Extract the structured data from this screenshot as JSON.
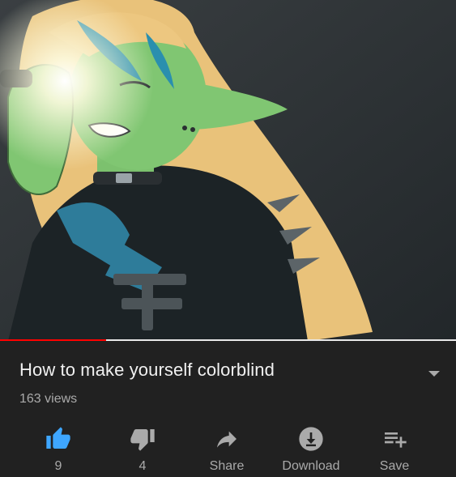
{
  "video": {
    "title": "How to make yourself colorblind",
    "views": "163 views",
    "progress_fraction": 0.232
  },
  "actions": {
    "like_count": "9",
    "dislike_count": "4",
    "share_label": "Share",
    "download_label": "Download",
    "save_label": "Save"
  },
  "colors": {
    "accent_like": "#3ea6ff",
    "progress": "#ff0000",
    "background": "#212121"
  }
}
